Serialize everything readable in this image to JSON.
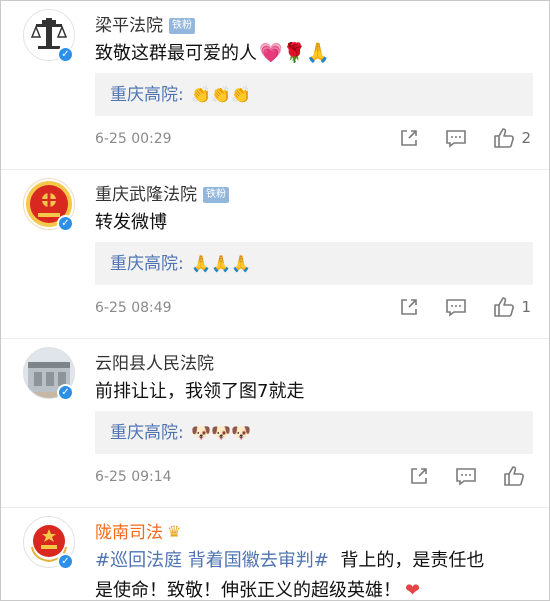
{
  "comments": [
    {
      "name": "梁平法院",
      "badge": "铁粉",
      "text": "致敬这群最可爱的人",
      "text_emoji": "💗🌹🙏",
      "quote_author": "重庆高院:",
      "quote_emoji": "👏👏👏",
      "time": "6-25 00:29",
      "like_count": "2"
    },
    {
      "name": "重庆武隆法院",
      "badge": "铁粉",
      "text": "转发微博",
      "quote_author": "重庆高院:",
      "quote_emoji": "🙏🙏🙏",
      "time": "6-25 08:49",
      "like_count": "1"
    },
    {
      "name": "云阳县人民法院",
      "text": "前排让让，我领了图7就走",
      "quote_author": "重庆高院:",
      "quote_emoji": "🐶🐶🐶",
      "time": "6-25 09:14",
      "like_count": ""
    },
    {
      "name": "陇南司法",
      "crown": "♛",
      "hashtag": "#巡回法庭 背着国徽去审判#",
      "text_a": "  背上的，是责任也",
      "text_b": "是使命！致敬！伸张正义的超级英雄！",
      "heart": "❤"
    }
  ],
  "icons": {
    "share": "share-icon",
    "comment": "comment-icon",
    "like": "thumbs-up-icon",
    "verified": "verified-icon"
  },
  "colors": {
    "link_blue": "#4f74b1",
    "vip_orange": "#f26b1d",
    "verified_blue": "#2d90e6",
    "quote_bg": "#f2f2f2"
  }
}
